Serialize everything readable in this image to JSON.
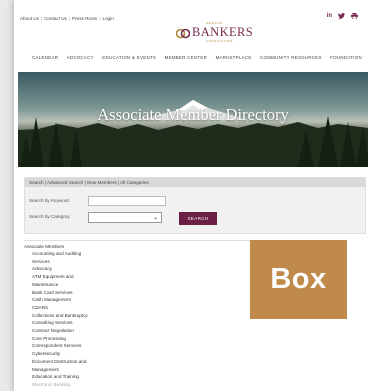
{
  "top_links": [
    "About Us",
    "Contact Us",
    "Press Room",
    "Login"
  ],
  "social": {
    "linkedin_icon": "in",
    "twitter_icon": "♥",
    "print_icon": "⎙"
  },
  "logo": {
    "word": "BANKERS",
    "tagline_top": "OREGON",
    "tagline_bottom": "ASSOCIATION",
    "brand_color": "#7a2a52"
  },
  "main_nav": [
    "CALENDAR",
    "ADVOCACY",
    "EDUCATION & EVENTS",
    "MEMBER CENTER",
    "MARKETPLACE",
    "COMMUNITY RESOURCES",
    "FOUNDATION"
  ],
  "banner": {
    "title": "Associate Member Directory"
  },
  "search": {
    "breadcrumb": "Search | Advanced Search | New Members | All Categories",
    "keyword_label": "Search by Keyword",
    "keyword_value": "",
    "category_label": "Search by Category",
    "category_value": "",
    "button_label": "SEARCH",
    "button_color": "#6b1f44"
  },
  "categories": {
    "heading": "Associate Members",
    "items": [
      "Accounting and Auditing",
      "Services",
      "Advocacy",
      "ATM Equipment and",
      "Maintenance",
      "Bank Card Services",
      "Cash Management",
      "CDARS",
      "Collections and Bankruptcy",
      "Consulting Services",
      "Contract Negotiation",
      "Core Processing",
      "Correspondent Services",
      "Cybersecurity",
      "Document Destruction and",
      "Management",
      "Education and Training",
      "Electronic Banking"
    ]
  },
  "promo": {
    "label": "Box",
    "color": "#c08a4a"
  }
}
